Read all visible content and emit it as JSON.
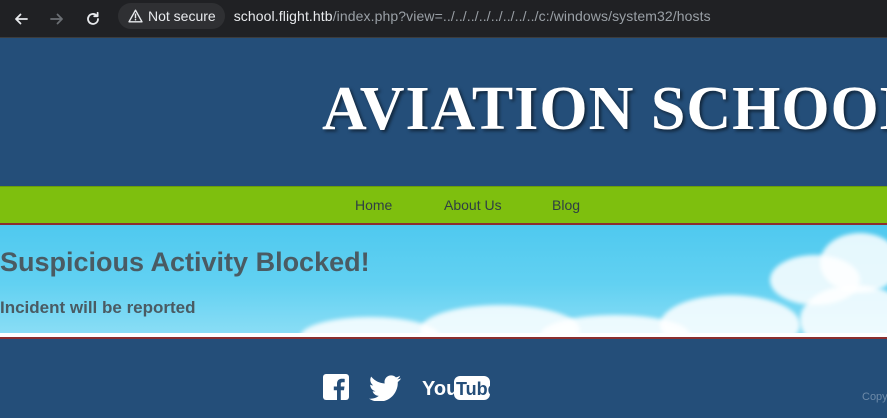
{
  "browser": {
    "security_label": "Not secure",
    "url_host": "school.flight.htb",
    "url_path": "/index.php?view=../../../../../../../../c:/windows/system32/hosts"
  },
  "site": {
    "title": "AVIATION SCHOOL"
  },
  "nav": {
    "items": [
      {
        "label": "Home"
      },
      {
        "label": "About Us"
      },
      {
        "label": "Blog"
      }
    ]
  },
  "content": {
    "heading": "Suspicious Activity Blocked!",
    "message": "Incident will be reported"
  },
  "footer": {
    "social_icons": [
      "facebook-icon",
      "twitter-icon",
      "youtube-icon"
    ],
    "youtube_label_you": "You",
    "youtube_label_tube": "Tube",
    "copyright_partial": "Copy"
  },
  "colors": {
    "header_bg": "#244e79",
    "nav_bg": "#7ebf0e",
    "accent_red": "#8b2e2e",
    "heading_text": "#4a5b63"
  }
}
